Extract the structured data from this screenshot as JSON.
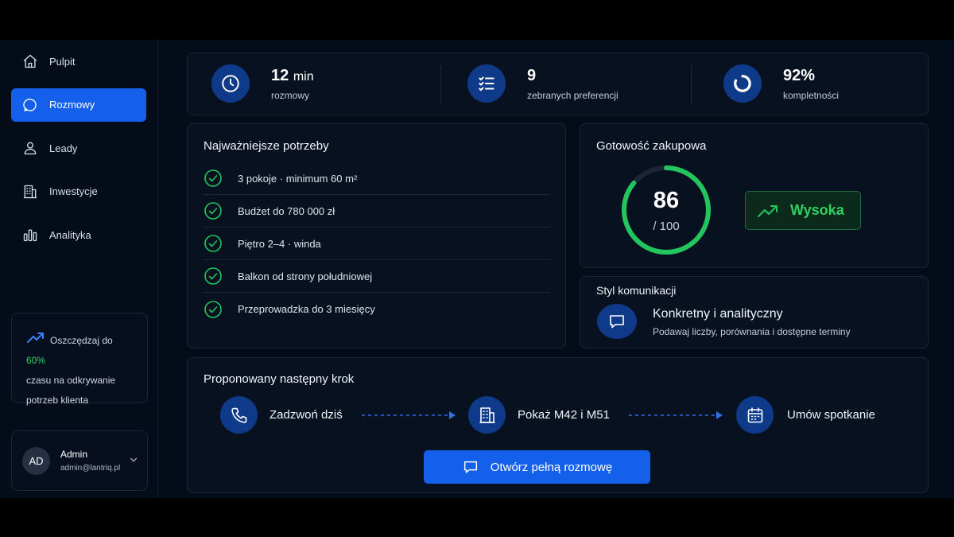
{
  "sidebar": {
    "items": [
      {
        "label": "Pulpit",
        "icon": "home-icon"
      },
      {
        "label": "Rozmowy",
        "icon": "chat-icon",
        "active": true
      },
      {
        "label": "Leady",
        "icon": "user-icon"
      },
      {
        "label": "Inwestycje",
        "icon": "building-icon"
      },
      {
        "label": "Analityka",
        "icon": "bar-chart-icon"
      }
    ],
    "promo": {
      "prefix": "Oszczędzaj do ",
      "highlight": "60%",
      "line2": "czasu na odkrywanie",
      "line3": "potrzeb klienta"
    },
    "user": {
      "initials": "AD",
      "name": "Admin",
      "email": "admin@lantriq.pl"
    }
  },
  "stats": [
    {
      "value": "12",
      "unit": "min",
      "label": "rozmowy",
      "icon": "clock-icon"
    },
    {
      "value": "9",
      "unit": "",
      "label": "zebranych preferencji",
      "icon": "checklist-icon"
    },
    {
      "value": "92%",
      "unit": "",
      "label": "kompletności",
      "icon": "progress-ring-icon"
    }
  ],
  "needs": {
    "title": "Najważniejsze potrzeby",
    "items": [
      "3 pokoje · minimum 60 m²",
      "Budżet do 780 000 zł",
      "Piętro 2–4 · winda",
      "Balkon od strony południowej",
      "Przeprowadzka do 3 miesięcy"
    ]
  },
  "readiness": {
    "title": "Gotowość zakupowa",
    "score": "86",
    "max": "/ 100",
    "score_fraction": 0.86,
    "badge": "Wysoka",
    "accent": "#22c55e"
  },
  "style": {
    "title": "Styl komunikacji",
    "name": "Konkretny i analityczny",
    "desc": "Podawaj liczby, porównania i dostępne terminy"
  },
  "next_step": {
    "title": "Proponowany następny krok",
    "steps": [
      {
        "label": "Zadzwoń dziś",
        "icon": "phone-icon"
      },
      {
        "label": "Pokaż M42 i M51",
        "icon": "building-icon"
      },
      {
        "label": "Umów spotkanie",
        "icon": "calendar-icon"
      }
    ],
    "cta": "Otwórz pełną rozmowę"
  },
  "colors": {
    "accent": "#1560ea",
    "success": "#22c55e",
    "background": "#050c19"
  }
}
